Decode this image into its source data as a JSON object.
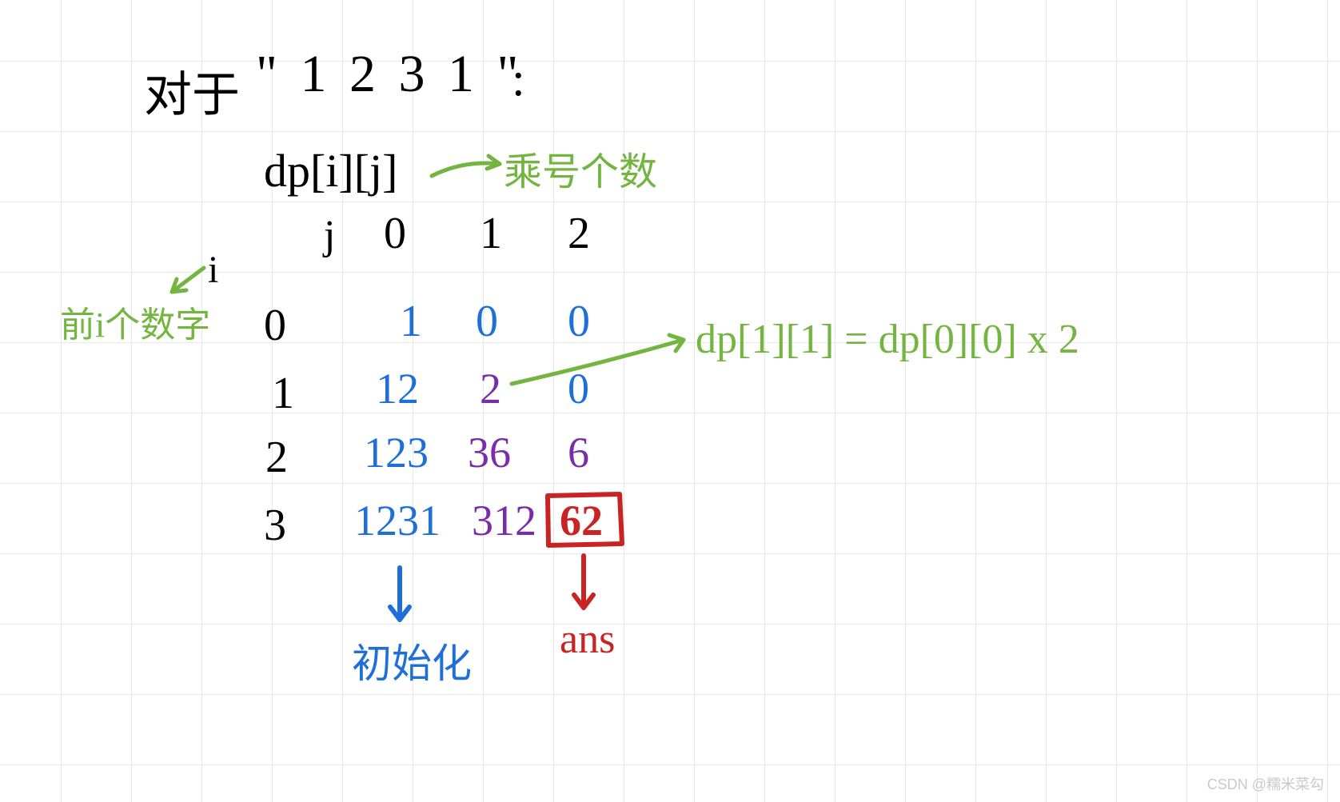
{
  "title_prefix": "对于",
  "title_string": "\" 1 2 3 1 \"",
  "title_colon": ":",
  "dp_label": "dp[i][j]",
  "col_header_j": "j",
  "row_header_i": "i",
  "cols": {
    "c0": "0",
    "c1": "1",
    "c2": "2"
  },
  "rows": {
    "r0": "0",
    "r1": "1",
    "r2": "2",
    "r3": "3"
  },
  "note_multiplier_count": "乘号个数",
  "note_prefix_digits": "前i个数字",
  "note_formula": "dp[1][1] = dp[0][0] x 2",
  "note_init": "初始化",
  "note_ans": "ans",
  "table": {
    "r0c0": "1",
    "r0c1": "0",
    "r0c2": "0",
    "r1c0": "12",
    "r1c1": "2",
    "r1c2": "0",
    "r2c0": "123",
    "r2c1": "36",
    "r2c2": "6",
    "r3c0": "1231",
    "r3c1": "312",
    "r3c2": "62"
  },
  "watermark": "CSDN @糯米菜勾",
  "chart_data": {
    "type": "table",
    "title": "dp[i][j] for \"1231\"",
    "row_axis_label": "i (前i个数字)",
    "col_axis_label": "j (乘号个数)",
    "row_headers": [
      0,
      1,
      2,
      3
    ],
    "col_headers": [
      0,
      1,
      2
    ],
    "cells": [
      [
        1,
        0,
        0
      ],
      [
        12,
        2,
        0
      ],
      [
        123,
        36,
        6
      ],
      [
        1231,
        312,
        62
      ]
    ],
    "annotations": [
      "dp[1][1] = dp[0][0] x 2",
      "column j=0 → 初始化",
      "dp[3][2] = 62 → ans"
    ]
  }
}
